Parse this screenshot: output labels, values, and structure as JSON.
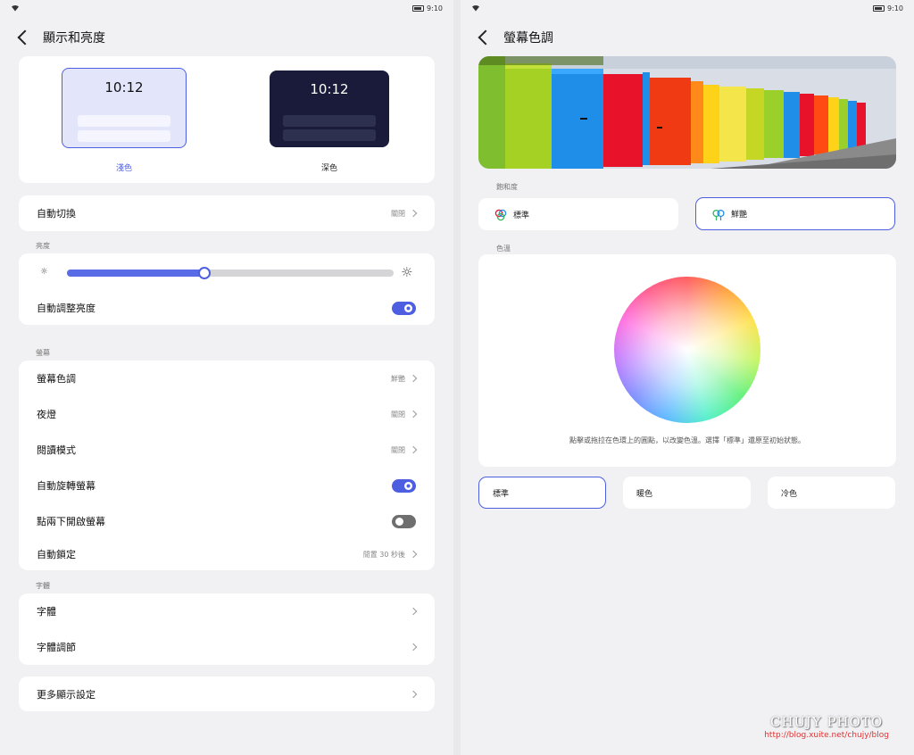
{
  "status": {
    "time": "9:10"
  },
  "left": {
    "title": "顯示和亮度",
    "themes": [
      {
        "label": "淺色",
        "time": "10:12"
      },
      {
        "label": "深色",
        "time": "10:12"
      }
    ],
    "auto_switch": {
      "label": "自動切換",
      "value": "關閉"
    },
    "brightness": {
      "section": "亮度",
      "level_percent": 42,
      "auto_label": "自動調整亮度"
    },
    "screen": {
      "section": "螢幕",
      "items": [
        {
          "label": "螢幕色調",
          "value": "鮮艷"
        },
        {
          "label": "夜燈",
          "value": "關閉"
        },
        {
          "label": "閱讀模式",
          "value": "關閉"
        },
        {
          "label": "自動旋轉螢幕",
          "toggle": "on"
        },
        {
          "label": "點兩下開啟螢幕",
          "toggle": "off"
        },
        {
          "label": "自動鎖定",
          "value": "閒置 30 秒後"
        }
      ]
    },
    "font": {
      "section": "字體",
      "items": [
        {
          "label": "字體"
        },
        {
          "label": "字體調節"
        }
      ]
    },
    "more": {
      "label": "更多顯示設定"
    }
  },
  "right": {
    "title": "螢幕色調",
    "saturation": {
      "section": "飽和度",
      "options": [
        {
          "label": "標準",
          "selected": false
        },
        {
          "label": "鮮艷",
          "selected": true
        }
      ]
    },
    "temperature": {
      "section": "色溫",
      "note": "點擊或拖拉在色環上的圓點，以改變色溫。選擇「標準」還原至初始狀態。",
      "options": [
        {
          "label": "標準",
          "selected": true
        },
        {
          "label": "暖色",
          "selected": false
        },
        {
          "label": "冷色",
          "selected": false
        }
      ]
    }
  },
  "watermark": {
    "line1": "CHUJY PHOTO",
    "line2": "http://blog.xuite.net/chujy/blog"
  },
  "colors": {
    "accent": "#4d5fe0",
    "dark_theme": "#1a1b3a",
    "light_theme": "#e3e5fb"
  }
}
